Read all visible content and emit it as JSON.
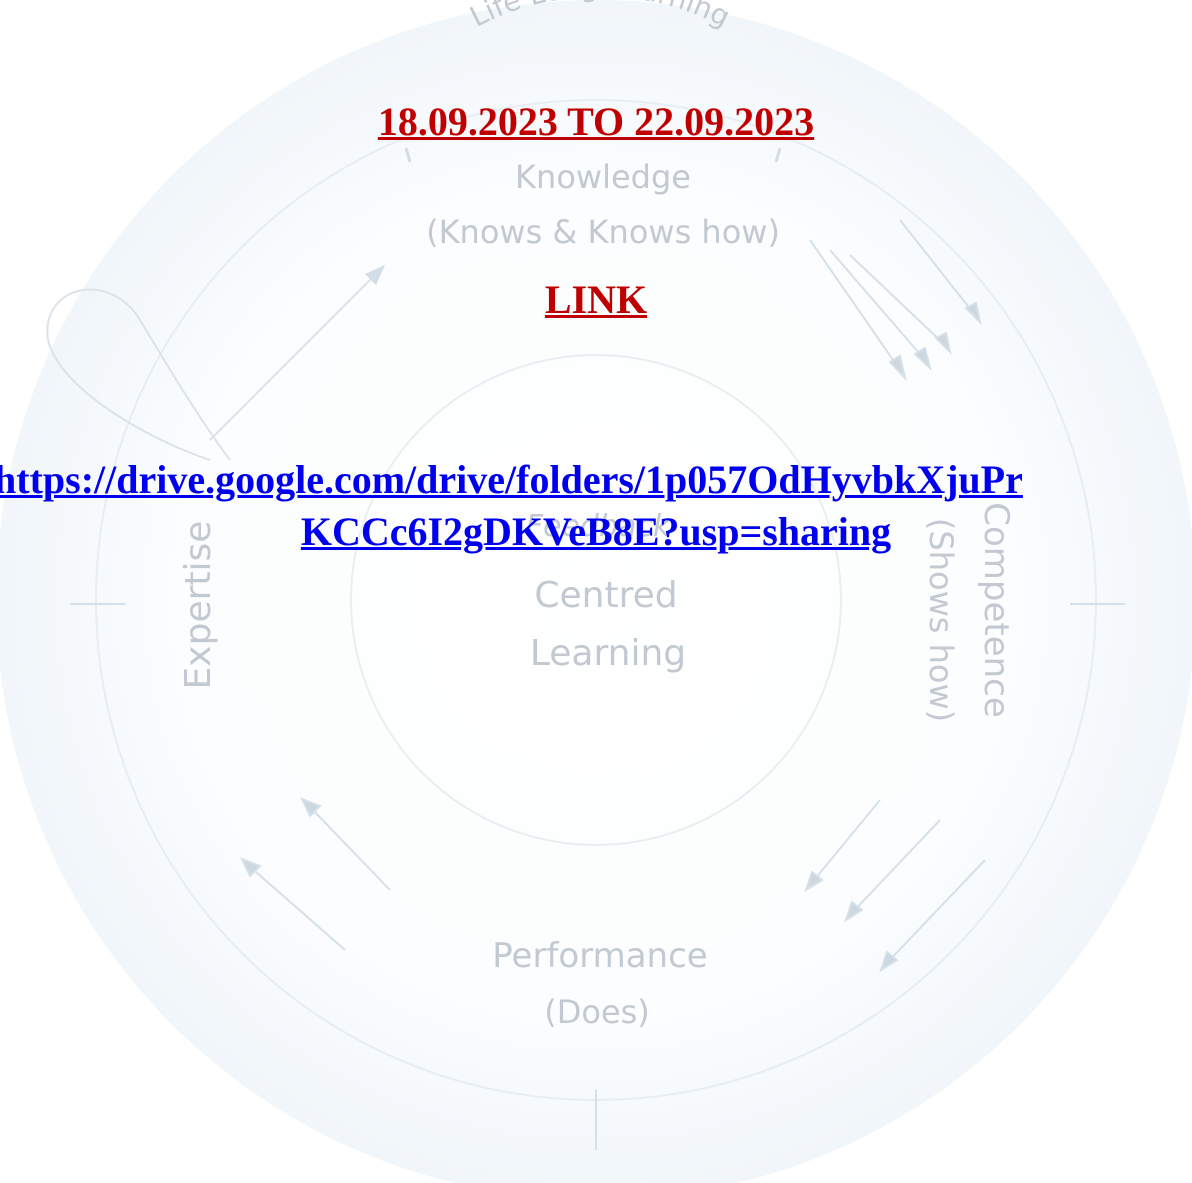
{
  "date_range": "18.09.2023 TO 22.09.2023",
  "link_heading": "LINK",
  "drive_link": {
    "line1": "https://drive.google.com/drive/folders/1p057OdHyvbkXjuPr",
    "line2": "KCCc6I2gDKVeB8E?usp=sharing"
  },
  "watermark": {
    "top_arc": "Life Long Learning",
    "knowledge": "Knowledge",
    "knowledge_sub": "(Knows & Knows how)",
    "center_line1": "Centred",
    "center_line2": "Learning",
    "left_side": "Expertise",
    "right_inner": "(Shows how)",
    "right_outer": "Competence",
    "feedback": "Feedback",
    "performance": "Performance",
    "performance_sub": "(Does)",
    "color": "#c2c9d2"
  },
  "colors": {
    "heading": "#c00000",
    "link": "#0000ee"
  }
}
